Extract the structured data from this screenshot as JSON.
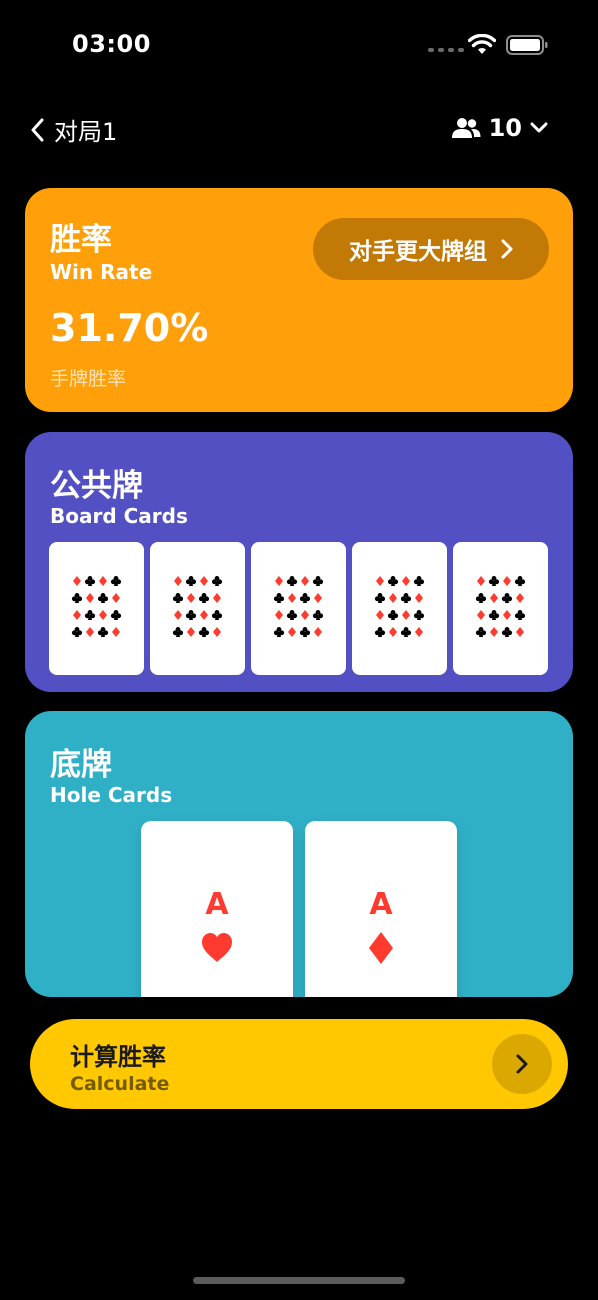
{
  "status_bar": {
    "time": "03:00"
  },
  "nav": {
    "back_label": "对局1",
    "players_count": "10"
  },
  "win_rate": {
    "title": "胜率",
    "subtitle": "Win Rate",
    "value": "31.70%",
    "caption": "手牌胜率",
    "opponent_button_label": "对手更大牌组"
  },
  "board": {
    "title": "公共牌",
    "subtitle": "Board Cards",
    "slots": [
      "empty",
      "empty",
      "empty",
      "empty",
      "empty"
    ]
  },
  "hole": {
    "title": "底牌",
    "subtitle": "Hole Cards",
    "cards": [
      {
        "rank": "A",
        "suit": "heart-icon"
      },
      {
        "rank": "A",
        "suit": "diamond-icon"
      }
    ]
  },
  "calculate": {
    "title": "计算胜率",
    "subtitle": "Calculate"
  },
  "colors": {
    "win_rate_card": "#ff9f0a",
    "board_card": "#5350c4",
    "hole_card": "#30b0c7",
    "calculate_button": "#ffc800",
    "red_suit": "#ff3b30"
  }
}
